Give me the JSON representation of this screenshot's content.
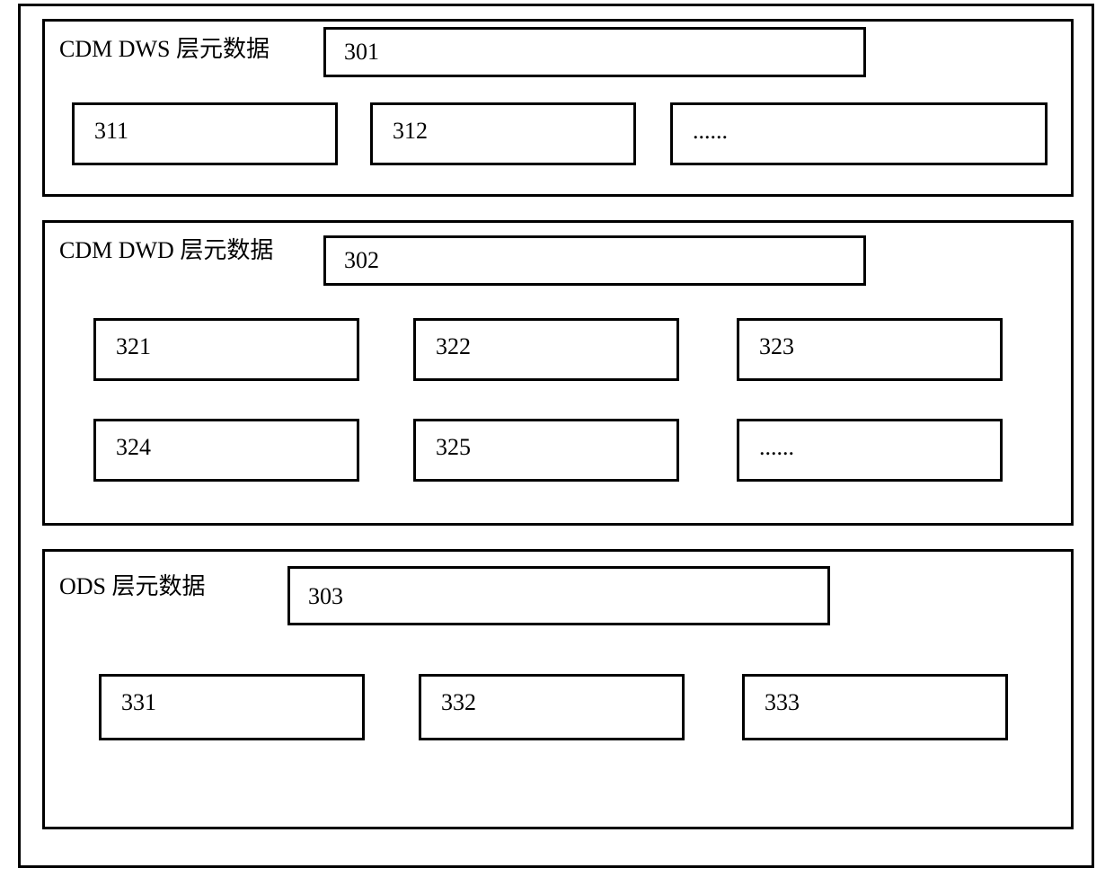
{
  "layers": {
    "dws": {
      "title": "CDM DWS 层元数据",
      "header": "301",
      "cells": {
        "c1": "311",
        "c2": "312",
        "c3": "......"
      }
    },
    "dwd": {
      "title": "CDM DWD 层元数据",
      "header": "302",
      "cells": {
        "c1": "321",
        "c2": "322",
        "c3": "323",
        "c4": "324",
        "c5": "325",
        "c6": "......"
      }
    },
    "ods": {
      "title": "ODS 层元数据",
      "header": "303",
      "cells": {
        "c1": "331",
        "c2": "332",
        "c3": "333"
      }
    }
  }
}
